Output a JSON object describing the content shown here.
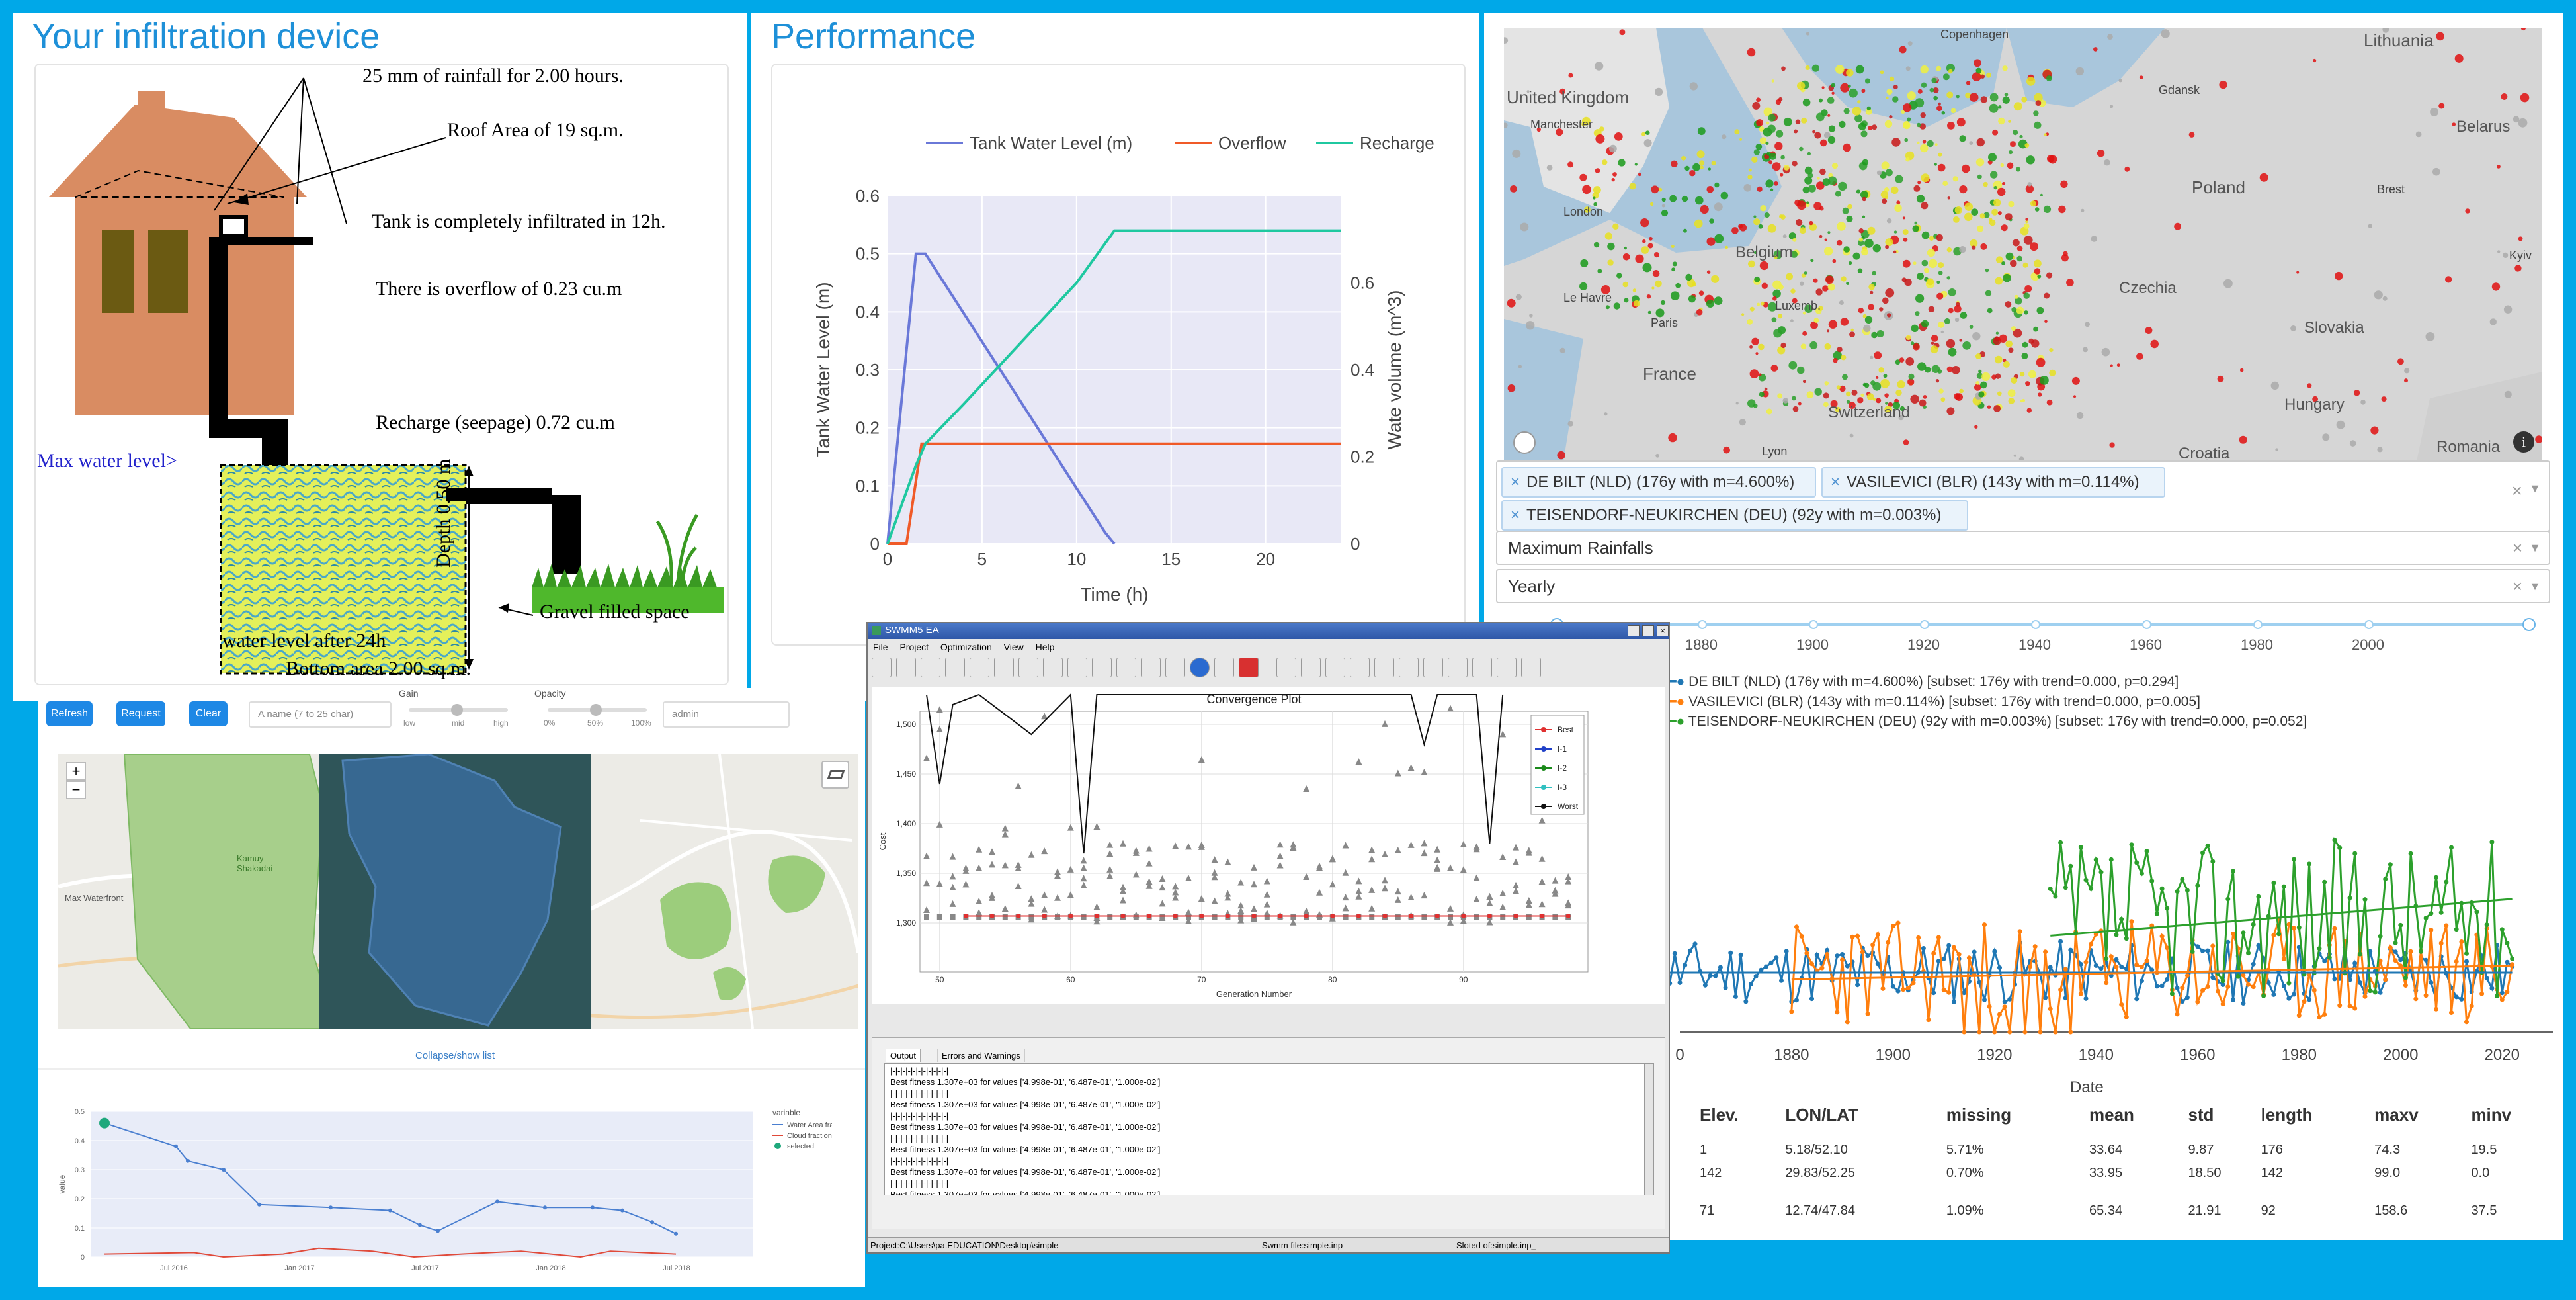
{
  "colors": {
    "frame": "#00a8e8",
    "accent": "#1e90d8"
  },
  "infiltration": {
    "title": "Your infiltration device",
    "rainfall": "25 mm of rainfall for 2.00 hours.",
    "roof_area": "Roof Area of 19 sq.m.",
    "tank_infiltrated": "Tank is completely infiltrated in 12h.",
    "overflow": "There is overflow of 0.23 cu.m",
    "recharge": "Recharge (seepage) 0.72 cu.m",
    "max_water_level": "Max water level>",
    "depth": "Depth 0.50 m",
    "gravel": "Gravel filled space",
    "water_level_after": "water level after 24h",
    "bottom_area": "Bottom area 2.00 sq.m."
  },
  "performance": {
    "title": "Performance",
    "chart_data": {
      "type": "line",
      "xlabel": "Time (h)",
      "ylabel": "Tank Water Level (m)",
      "y2label": "Wate volume (m^3)",
      "xlim": [
        0,
        24
      ],
      "ylim": [
        0,
        0.6
      ],
      "y2lim": [
        0,
        0.8
      ],
      "xticks": [
        "0",
        "5",
        "10",
        "15",
        "20"
      ],
      "yticks": [
        "0",
        "0.1",
        "0.2",
        "0.3",
        "0.4",
        "0.5",
        "0.6"
      ],
      "y2ticks": [
        "0",
        "0.2",
        "0.4",
        "0.6"
      ],
      "series": [
        {
          "name": "Tank Water Level (m)",
          "color": "#6a78d8",
          "axis": "y",
          "points": [
            [
              0,
              0
            ],
            [
              1.5,
              0.5
            ],
            [
              2,
              0.5
            ],
            [
              11.5,
              0.02
            ],
            [
              12,
              0
            ]
          ]
        },
        {
          "name": "Overflow",
          "color": "#f05a28",
          "axis": "y2",
          "points": [
            [
              0,
              0
            ],
            [
              1,
              0
            ],
            [
              1.8,
              0.23
            ],
            [
              24,
              0.23
            ]
          ]
        },
        {
          "name": "Recharge",
          "color": "#1fc8a0",
          "axis": "y2",
          "points": [
            [
              0,
              0
            ],
            [
              1.5,
              0.18
            ],
            [
              2,
              0.23
            ],
            [
              4,
              0.32
            ],
            [
              10,
              0.6
            ],
            [
              12,
              0.72
            ],
            [
              24,
              0.72
            ]
          ]
        }
      ]
    }
  },
  "mapviewer": {
    "buttons": [
      "Refresh",
      "Request",
      "Clear"
    ],
    "name_placeholder": "A name (7 to 25 char)",
    "gain_label": "Gain",
    "gain_ticks": [
      "low",
      "mid",
      "high"
    ],
    "opacity_label": "Opacity",
    "opacity_ticks": [
      "0%",
      "50%",
      "100%"
    ],
    "user_value": "admin",
    "zoom_in": "+",
    "zoom_out": "−",
    "place1": "Max Waterfront",
    "place2": "Kamuy Shakadai",
    "collapse": "Collapse/show list",
    "chart": {
      "legend_title": "variable",
      "legend": [
        "Water Area frac.",
        "Cloud fraction",
        "selected"
      ],
      "ylabel": "value",
      "xticks": [
        "Jul 2016",
        "Jan 2017",
        "Jul 2017",
        "Jan 2018",
        "Jul 2018"
      ],
      "yticks": [
        "0",
        "0.1",
        "0.2",
        "0.3",
        "0.4",
        "0.5"
      ]
    }
  },
  "swmm": {
    "title": "SWMM5 EA",
    "menu": [
      "File",
      "Project",
      "Optimization",
      "View",
      "Help"
    ],
    "plot_title": "Convergence Plot",
    "xlabel": "Generation Number",
    "ylabel": "Cost",
    "yticks": [
      "1,500",
      "1,450",
      "1,400",
      "1,350",
      "1,300"
    ],
    "xticks": [
      "50",
      "60",
      "70",
      "80",
      "90"
    ],
    "legend": [
      "Best",
      "I-1",
      "I-2",
      "I-3",
      "Worst"
    ],
    "tabs": [
      "Output",
      "Errors and Warnings"
    ],
    "log_fitness": "Best fitness 1.307e+03 for values ['4.998e-01', '6.487e-01', '1.000e-02']",
    "log_bar": "|-|-|-|-|-|-|-|-|-|-|-|",
    "status_project": "Project:C:\\Users\\pa.EDUCATION\\Desktop\\simple",
    "status_swmm": "Swmm file:simple.inp",
    "status_slot": "Sloted of:simple.inp_"
  },
  "rainfall_map": {
    "countries": [
      "United Kingdom",
      "Lithuania",
      "Gdansk",
      "Belarus",
      "Manchester",
      "London",
      "Belgium",
      "Poland",
      "Brest",
      "Kyiv",
      "Le Havre",
      "Paris",
      "Luxemb.",
      "Czechia",
      "Slovakia",
      "France",
      "Switzerland",
      "Hungary",
      "Lyon",
      "Croatia",
      "Romania",
      "Copenhagen"
    ],
    "selected": [
      "DE BILT (NLD) (176y with m=4.600%)",
      "VASILEVICI (BLR) (143y with m=0.114%)",
      "TEISENDORF-NEUKIRCHEN (DEU) (92y with m=0.003%)"
    ],
    "measure": "Maximum Rainfalls",
    "period": "Yearly",
    "slider_years": [
      "1880",
      "1900",
      "1920",
      "1940",
      "1960",
      "1980",
      "2000"
    ],
    "series_legend": [
      "DE BILT (NLD) (176y with m=4.600%) [subset: 176y with trend=0.000, p=0.294]",
      "VASILEVICI (BLR) (143y with m=0.114%) [subset: 176y with trend=0.000, p=0.005]",
      "TEISENDORF-NEUKIRCHEN (DEU) (92y with m=0.003%) [subset: 176y with trend=0.000, p=0.052]"
    ],
    "xticks": [
      "0",
      "1880",
      "1900",
      "1920",
      "1940",
      "1960",
      "1980",
      "2000",
      "2020"
    ],
    "xlabel": "Date",
    "table": {
      "headers": [
        "Elev.",
        "LON/LAT",
        "missing",
        "mean",
        "std",
        "length",
        "maxv",
        "minv"
      ],
      "rows": [
        [
          "1",
          "5.18/52.10",
          "5.71%",
          "33.64",
          "9.87",
          "176",
          "74.3",
          "19.5"
        ],
        [
          "142",
          "29.83/52.25",
          "0.70%",
          "33.95",
          "18.50",
          "142",
          "99.0",
          "0.0"
        ],
        [
          "71",
          "12.74/47.84",
          "1.09%",
          "65.34",
          "21.91",
          "92",
          "158.6",
          "37.5"
        ]
      ]
    }
  }
}
